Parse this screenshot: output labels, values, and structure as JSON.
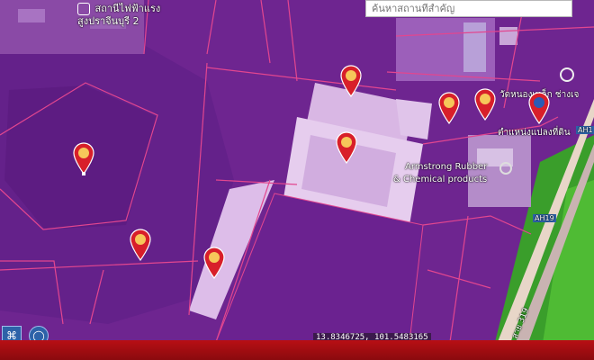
{
  "search": {
    "placeholder": "ค้นหาสถานที่สำคัญ"
  },
  "labels": {
    "top_left_line1": "สถานีไฟฟ้าแรง",
    "top_left_line2": "สูงปราจีนบุรี 2",
    "company_line1": "Armstrong Rubber",
    "company_line2": "& Chemical products",
    "parcel_position": "ตำแหน่งแปลงที่ดิน",
    "top_right": "วัดหนองเหล็ก ช่างเจ",
    "road_ah19": "AH19",
    "road_ah1": "AH1",
    "road_side": "สาย 319"
  },
  "coordinates": "13.8346725, 101.5483165",
  "pins": [
    {
      "id": "pin-1",
      "kind": "place"
    },
    {
      "id": "pin-2",
      "kind": "place"
    },
    {
      "id": "pin-3",
      "kind": "place"
    },
    {
      "id": "pin-4",
      "kind": "place"
    },
    {
      "id": "pin-5",
      "kind": "place"
    },
    {
      "id": "pin-6",
      "kind": "place"
    },
    {
      "id": "pin-7",
      "kind": "place"
    },
    {
      "id": "pin-8",
      "kind": "selected-parcel"
    }
  ],
  "colors": {
    "overlay": "#7a2aa0",
    "parcel_line": "#e0458f",
    "pin_red": "#d81f2a",
    "pin_yellow": "#f6c75a",
    "selected_pin": "#2b5bb4",
    "road": "#f0e0d0",
    "field_green": "#3fae2a",
    "bottom_bar": "#a50d12"
  },
  "icons": [
    "location-pin-icon",
    "search-icon",
    "location-circle-icon",
    "tool-icon"
  ]
}
